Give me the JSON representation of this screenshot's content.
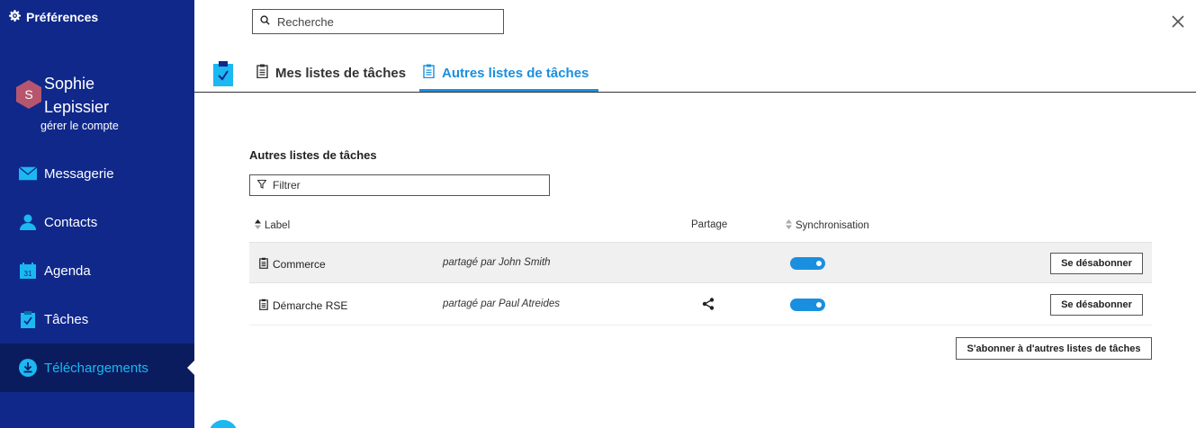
{
  "sidebar": {
    "header": "Préférences",
    "user": {
      "initial": "S",
      "first_name": "Sophie",
      "last_name": "Lepissier",
      "manage_label": "gérer le compte"
    },
    "items": [
      {
        "label": "Messagerie",
        "icon": "mail-icon"
      },
      {
        "label": "Contacts",
        "icon": "person-icon"
      },
      {
        "label": "Agenda",
        "icon": "calendar-icon",
        "icon_text": "31"
      },
      {
        "label": "Tâches",
        "icon": "clipboard-check-icon"
      },
      {
        "label": "Téléchargements",
        "icon": "download-icon",
        "active": true
      }
    ]
  },
  "search": {
    "placeholder": "Recherche"
  },
  "tabs": [
    {
      "label": "Mes listes de tâches",
      "active": false
    },
    {
      "label": "Autres listes de tâches",
      "active": true
    }
  ],
  "main": {
    "title": "Autres listes de tâches",
    "filter_placeholder": "Filtrer",
    "columns": {
      "label": "Label",
      "share": "Partage",
      "sync": "Synchronisation"
    },
    "rows": [
      {
        "name": "Commerce",
        "owner": "partagé par John Smith",
        "shared_icon": false,
        "sync": true,
        "action": "Se désabonner"
      },
      {
        "name": "Démarche RSE",
        "owner": "partagé par Paul Atreides",
        "shared_icon": true,
        "sync": true,
        "action": "Se désabonner"
      }
    ],
    "subscribe_label": "S'abonner à d'autres listes de tâches"
  },
  "colors": {
    "sidebar_bg": "#10288a",
    "sidebar_active_bg": "#0a1c5e",
    "accent": "#1a8fe0",
    "active_nav_text": "#1bb8f2",
    "avatar_bg": "#b5566e"
  }
}
